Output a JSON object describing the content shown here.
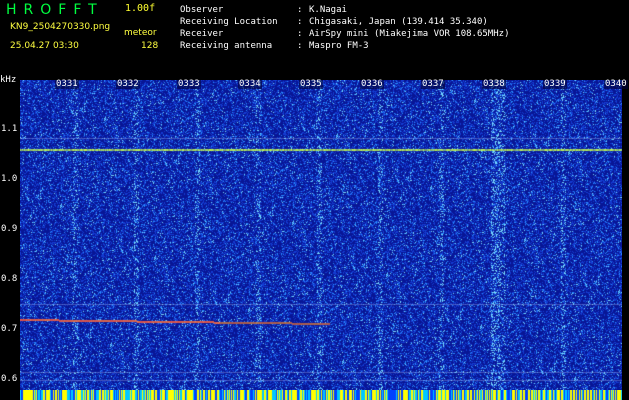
{
  "header": {
    "logo": "HROFFT",
    "version": "1.00f",
    "filename": "KN9_2504270330.png",
    "mode": "meteor",
    "datetime": "25.04.27 03:30",
    "count": "128"
  },
  "info": [
    {
      "label": "Observer",
      "value": "K.Nagai"
    },
    {
      "label": "Receiving Location",
      "value": "Chigasaki, Japan (139.414 35.340)"
    },
    {
      "label": "Receiver",
      "value": "AirSpy mini (Miakejima VOR 108.65MHz)"
    },
    {
      "label": "Receiving antenna",
      "value": "Maspro FM-3"
    }
  ],
  "yaxis": {
    "unit": "kHz",
    "ticks": [
      "1.1",
      "1.0",
      "0.9",
      "0.8",
      "0.7",
      "0.6"
    ]
  },
  "time_ticks": [
    "0331",
    "0332",
    "0333",
    "0334",
    "0335",
    "0336",
    "0337",
    "0338",
    "0339",
    "0340"
  ],
  "colors": {
    "background": "#0b1aa8",
    "noise_bright": "#3ca0ff",
    "signal": "#f0ff40",
    "meteor": "#ff6040",
    "bottom_bar": "#ffff00"
  }
}
